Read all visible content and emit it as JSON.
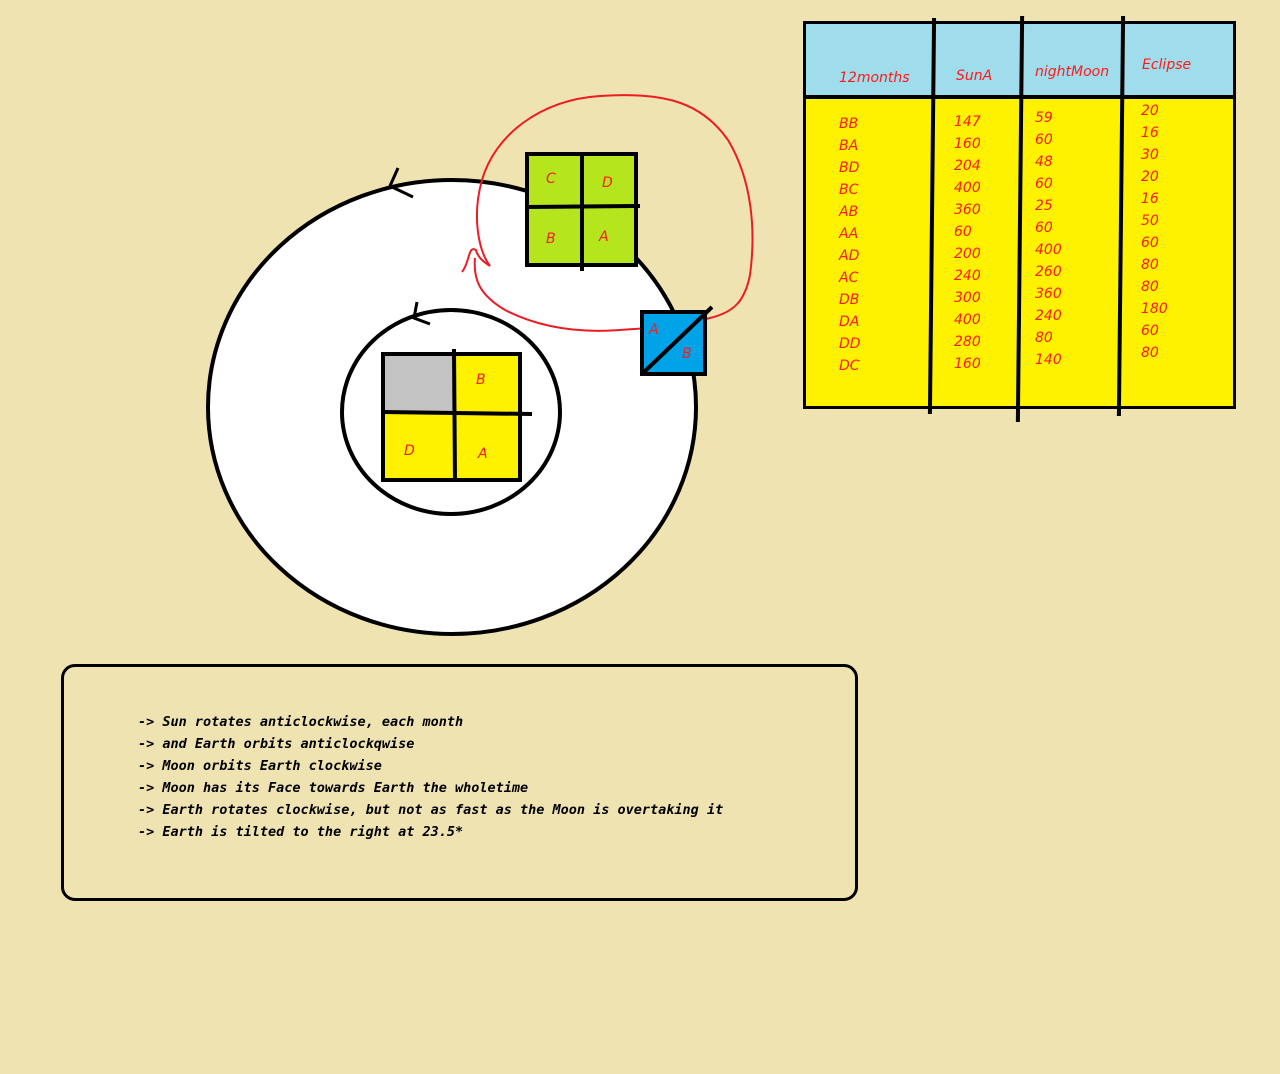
{
  "colors": {
    "background": "#efe3b1",
    "sun_yellow": "#fff200",
    "sun_shadow": "#c3c3c3",
    "earth_green": "#b5e61d",
    "moon_blue": "#00a2e8",
    "orbit_red": "#ed1c24",
    "table_header": "#9fdcec",
    "label_red": "#ff1a1a"
  },
  "diagram": {
    "sun": {
      "icon": "sun-square",
      "quadrants": {
        "top_left": "",
        "top_right": "B",
        "bottom_left": "D",
        "bottom_right": "A"
      }
    },
    "earth": {
      "icon": "earth-square",
      "quadrants": {
        "top_left": "C",
        "top_right": "D",
        "bottom_left": "B",
        "bottom_right": "A"
      }
    },
    "moon": {
      "icon": "moon-square",
      "halves": {
        "top_left": "A",
        "bottom_right": "B"
      }
    },
    "orbit_arrows": [
      "anticlockwise-arrow-icon",
      "anticlockwise-arrow-icon"
    ]
  },
  "table": {
    "headers": [
      "12months",
      "SunA",
      "nightMoon",
      "Eclipse"
    ],
    "columns": [
      [
        "BB",
        "BA",
        "BD",
        "BC",
        "AB",
        "AA",
        "AD",
        "AC",
        "DB",
        "DA",
        "DD",
        "DC"
      ],
      [
        "147",
        "160",
        "204",
        "400",
        "360",
        "60",
        "200",
        "240",
        "300",
        "400",
        "280",
        "160"
      ],
      [
        "59",
        "60",
        "48",
        "60",
        "25",
        "60",
        "400",
        "260",
        "360",
        "240",
        "80",
        "140"
      ],
      [
        "20",
        "16",
        "30",
        "20",
        "16",
        "50",
        "60",
        "80",
        "80",
        "180",
        "60",
        "80"
      ]
    ]
  },
  "notes": [
    "-> Sun rotates anticlockwise, each month",
    "-> and Earth orbits anticlockqwise",
    "-> Moon orbits Earth clockwise",
    "-> Moon has its Face towards Earth the wholetime",
    "-> Earth rotates clockwise, but not as fast as the Moon is overtaking it",
    "-> Earth is tilted to the right at 23.5*"
  ]
}
